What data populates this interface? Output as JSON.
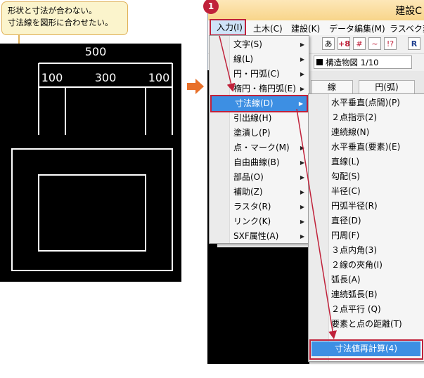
{
  "callout": {
    "line1": "形状と寸法が合わない。",
    "line2": "寸法線を図形に合わせたい。"
  },
  "drawing": {
    "dim_total": "500",
    "dim_left": "100",
    "dim_mid": "300",
    "dim_right": "100"
  },
  "app": {
    "title": "建設C",
    "step_badge": "1",
    "menubar": [
      "入力(I)",
      "土木(C)",
      "建設(K)",
      "データ編集(M)",
      "ラスベク変"
    ],
    "layer_label": "構造物図 1/10",
    "tabs": [
      "線",
      "円(弧)"
    ],
    "toolbar_glyphs": [
      "あ",
      "+8",
      "#",
      "~",
      "!?",
      "R"
    ]
  },
  "input_menu": {
    "items": [
      {
        "label": "文字(S)",
        "sub": true
      },
      {
        "label": "線(L)",
        "sub": true
      },
      {
        "label": "円・円弧(C)",
        "sub": true
      },
      {
        "label": "楕円・楕円弧(E)",
        "sub": true
      },
      {
        "label": "寸法線(D)",
        "sub": true
      },
      {
        "label": "引出線(H)",
        "sub": false
      },
      {
        "label": "塗潰し(P)",
        "sub": false
      },
      {
        "label": "点・マーク(M)",
        "sub": true
      },
      {
        "label": "自由曲線(B)",
        "sub": true
      },
      {
        "label": "部品(O)",
        "sub": true
      },
      {
        "label": "補助(Z)",
        "sub": true
      },
      {
        "label": "ラスタ(R)",
        "sub": true
      },
      {
        "label": "リンク(K)",
        "sub": true
      },
      {
        "label": "SXF属性(A)",
        "sub": true
      }
    ]
  },
  "dim_menu": {
    "items": [
      "水平垂直(点間)(P)",
      "２点指示(2)",
      "連続線(N)",
      "水平垂直(要素)(E)",
      "直線(L)",
      "勾配(S)",
      "半径(C)",
      "円弧半径(R)",
      "直径(D)",
      "円周(F)",
      "３点内角(3)",
      "２線の夾角(I)",
      "弧長(A)",
      "連続弧長(B)",
      "２点平行 (Q)",
      "要素と点の距離(T)",
      "寸法値再計算(4)"
    ]
  },
  "colors": {
    "accent_red": "#c0213a",
    "highlight_blue": "#3d8fe3",
    "arrow_orange": "#e8702a",
    "callout_fill": "#fbf4cc"
  }
}
